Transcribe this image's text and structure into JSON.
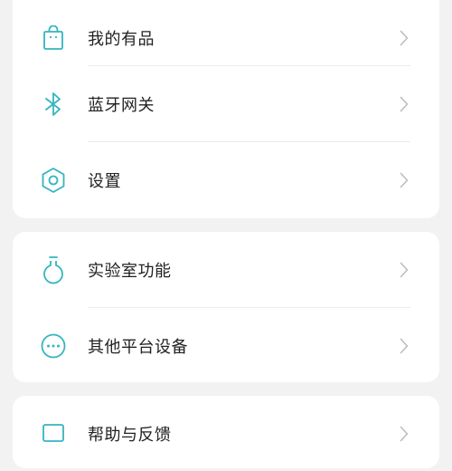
{
  "colors": {
    "accent": "#33b5bf",
    "chevron": "#bdbdbd",
    "text": "#222222",
    "background": "#f2f2f2",
    "card": "#ffffff"
  },
  "group1": {
    "items": [
      {
        "label": "我的有品",
        "icon": "shopping-bag-icon"
      },
      {
        "label": "蓝牙网关",
        "icon": "bluetooth-icon"
      },
      {
        "label": "设置",
        "icon": "hexagon-settings-icon"
      }
    ]
  },
  "group2": {
    "items": [
      {
        "label": "实验室功能",
        "icon": "flask-icon"
      },
      {
        "label": "其他平台设备",
        "icon": "more-dots-icon"
      }
    ]
  },
  "group3": {
    "items": [
      {
        "label": "帮助与反馈",
        "icon": "feedback-icon"
      }
    ]
  }
}
